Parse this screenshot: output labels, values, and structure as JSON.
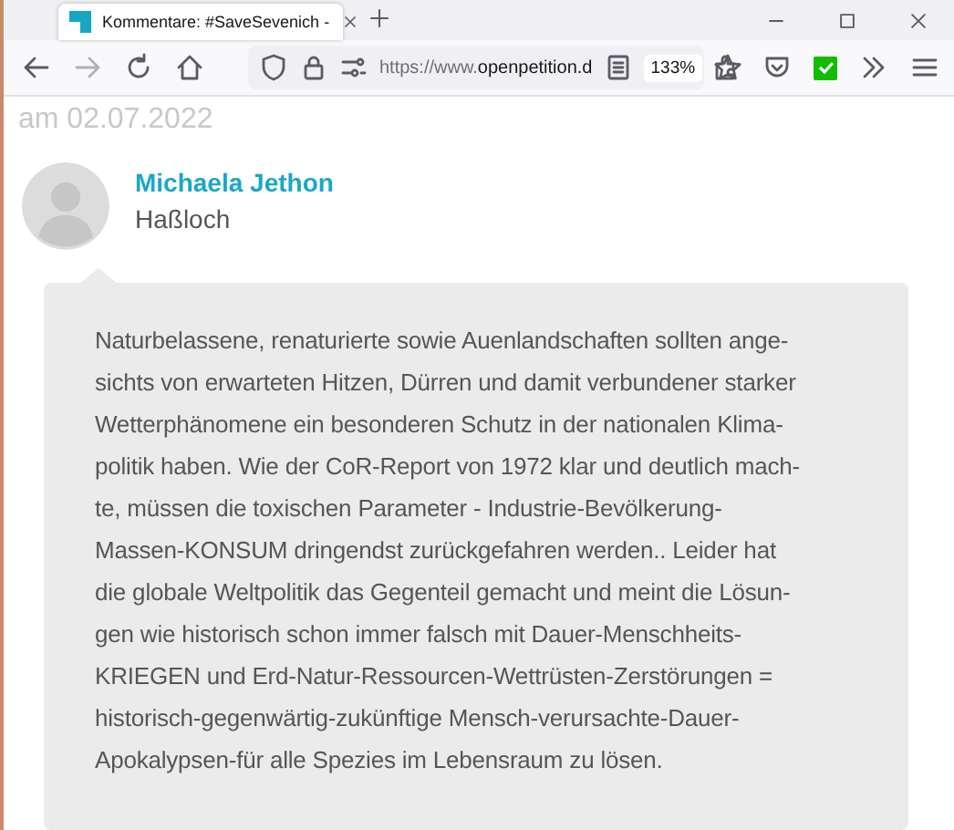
{
  "browser": {
    "tab": {
      "title": "Kommentare: #SaveSevenich -",
      "selected": true
    },
    "url": {
      "prefix": "https://www.",
      "domain": "openpetition.d"
    },
    "zoom": "133%"
  },
  "comment": {
    "date": "am 02.07.2022",
    "author": "Michaela Jethon",
    "location": "Haßloch",
    "lines": [
      "Naturbelassene, renaturierte sowie Auenlandschaften sollten ange-",
      "sichts von erwarteten Hitzen, Dürren und damit verbundener starker",
      "Wetterphänomene ein besonderen Schutz in der nationalen Klima-",
      "politik haben. Wie der CoR-Report von 1972 klar und deutlich mach-",
      "te, müssen die toxischen Parameter - Industrie-Bevölkerung-",
      "Massen-KONSUM dringendst zurückgefahren werden.. Leider hat",
      "die globale Weltpolitik das Gegenteil gemacht und meint die Lösun-",
      "gen wie historisch schon immer falsch mit Dauer-Menschheits-",
      "KRIEGEN und Erd-Natur-Ressourcen-Wettrüsten-Zerstörungen =",
      "historisch-gegenwärtig-zukünftige Mensch-verursachte-Dauer-",
      "Apokalypsen-für alle Spezies im Lebensraum zu lösen."
    ]
  }
}
